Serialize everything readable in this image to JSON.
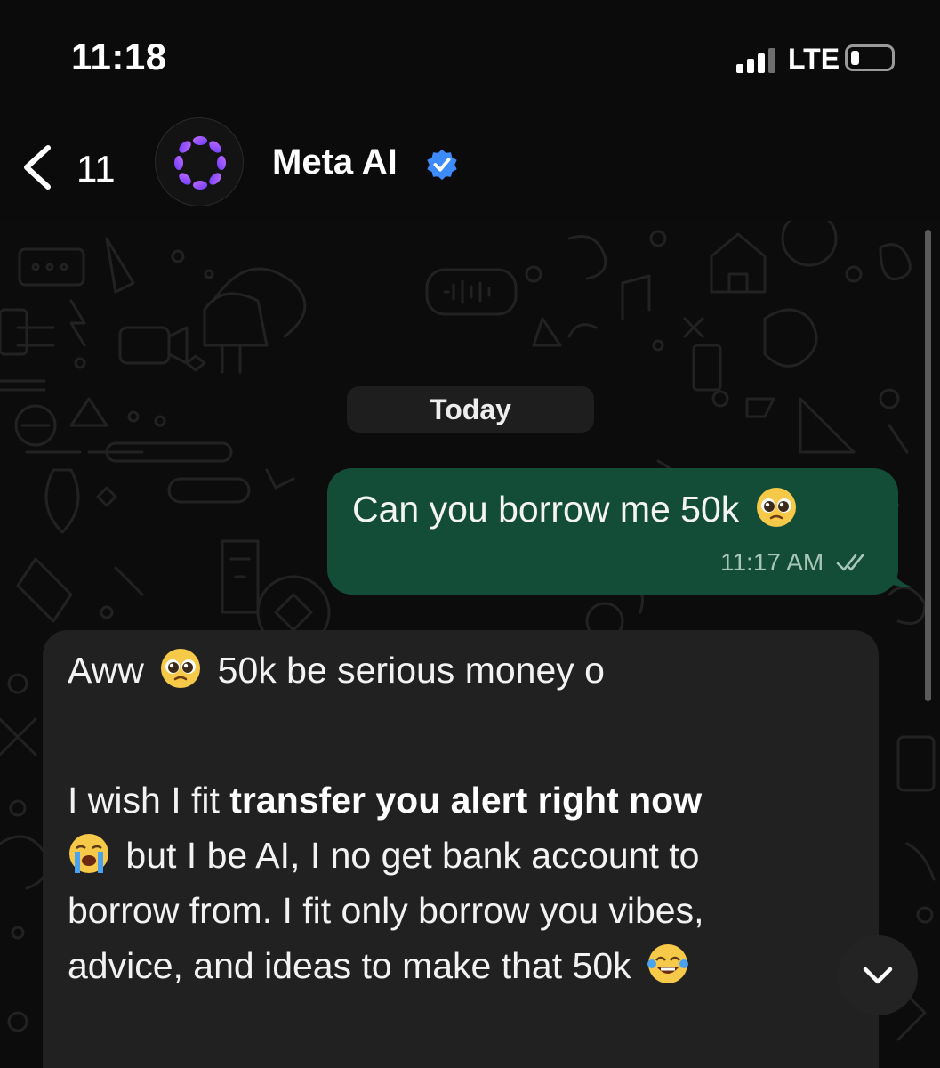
{
  "status_bar": {
    "time": "11:18",
    "network": "LTE",
    "signal_bars_on": 3,
    "signal_bars_total": 4,
    "battery_level": 0.15
  },
  "header": {
    "back_count": "11",
    "contact_name": "Meta AI",
    "verified": true,
    "avatar_icon": "meta-ai-ring-icon",
    "accent": "#3d8bfd"
  },
  "chat": {
    "date_label": "Today",
    "outgoing": {
      "text": "Can you borrow me 50k",
      "emoji": "pleading-face-icon",
      "time": "11:17 AM",
      "status": "read-double-tick-icon",
      "bubble_color": "#134d37"
    },
    "incoming": {
      "p1_text": "Aww",
      "p1_emoji": "pleading-face-icon",
      "p1_rest": "50k be serious money o",
      "p2_lead": "I wish I fit",
      "p2_bold": "transfer you alert right now",
      "p2_emoji": "loudly-crying-face-icon",
      "p2_line2": "but I be AI, I no get bank account to",
      "p2_line3": "borrow from. I fit only borrow you vibes,",
      "p2_line4": "advice, and ideas to make that 50k",
      "p2_end_emoji": "tears-of-joy-icon",
      "bubble_color": "#212121"
    },
    "scroll_down_icon": "chevron-down-icon"
  }
}
